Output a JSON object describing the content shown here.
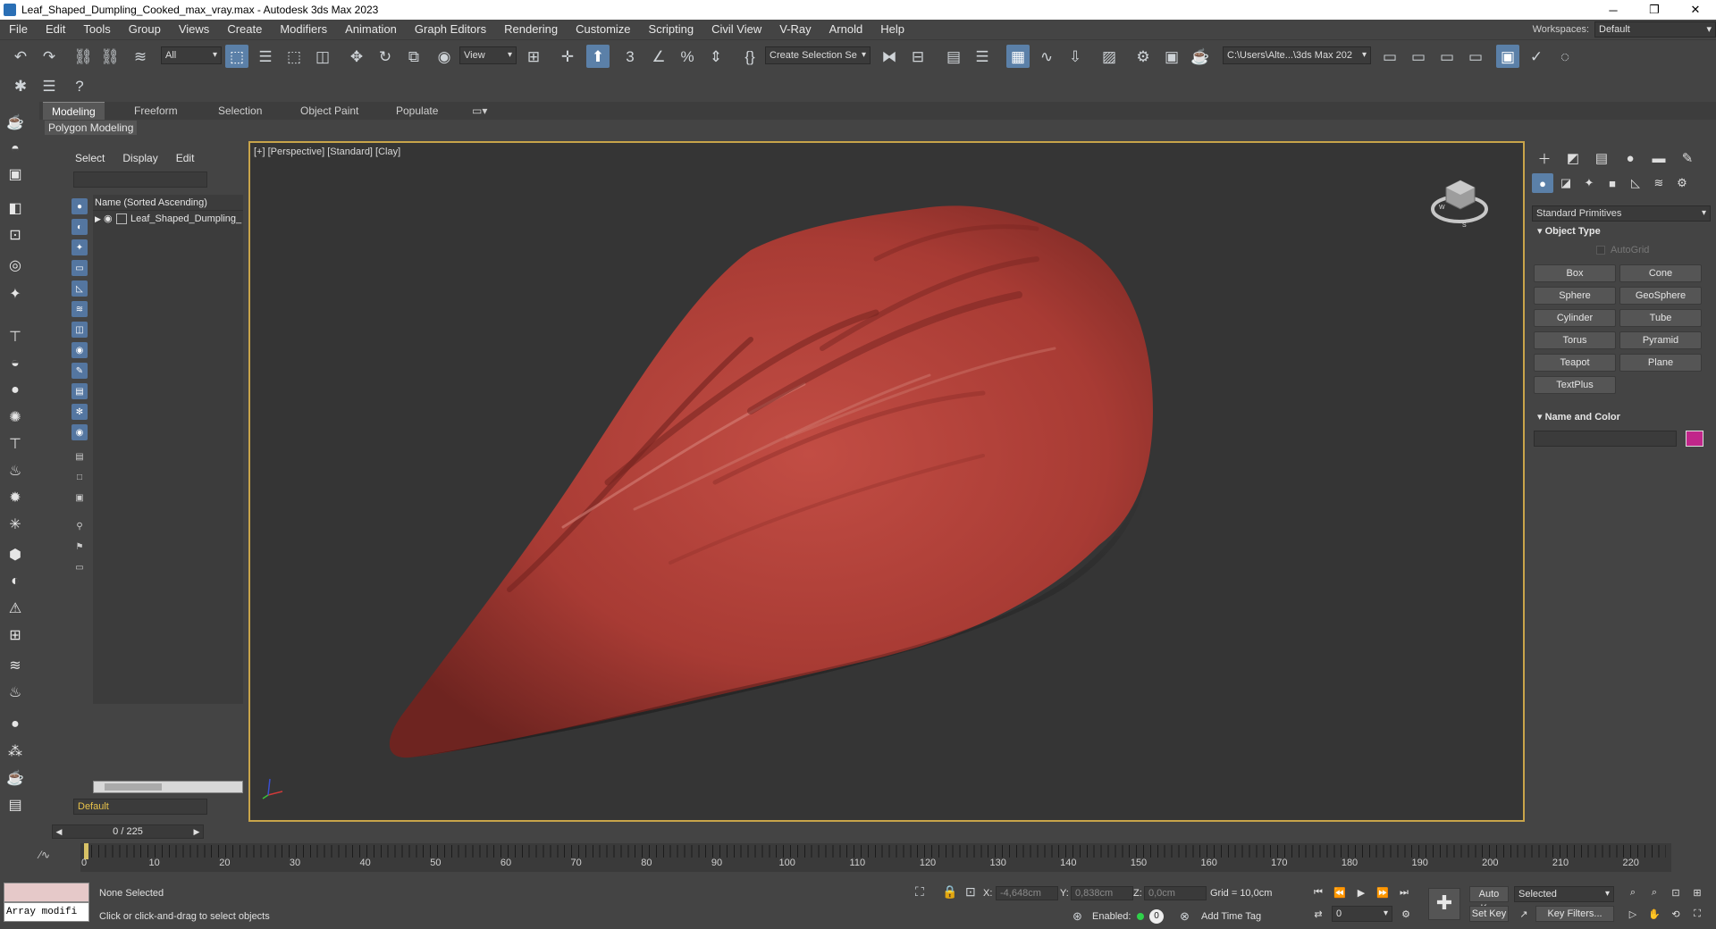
{
  "window": {
    "title": "Leaf_Shaped_Dumpling_Cooked_max_vray.max - Autodesk 3ds Max 2023",
    "controls": [
      "─",
      "❐",
      "✕"
    ]
  },
  "menu": {
    "items": [
      "File",
      "Edit",
      "Tools",
      "Group",
      "Views",
      "Create",
      "Modifiers",
      "Animation",
      "Graph Editors",
      "Rendering",
      "Customize",
      "Scripting",
      "Civil View",
      "V-Ray",
      "Arnold",
      "Help"
    ],
    "workspaces_label": "Workspaces:",
    "workspace_value": "Default"
  },
  "toolbar": {
    "selection_filter": "All",
    "ref_coord": "View",
    "named_selection": "Create Selection Se",
    "project_path": "C:\\Users\\Alte...\\3ds Max 202"
  },
  "ribbon": {
    "tabs": [
      "Modeling",
      "Freeform",
      "Selection",
      "Object Paint",
      "Populate"
    ],
    "panel_label": "Polygon Modeling"
  },
  "scene_explorer": {
    "tabs": [
      "Select",
      "Display",
      "Edit"
    ],
    "column_header": "Name (Sorted Ascending)",
    "rows": [
      "Leaf_Shaped_Dumpling_"
    ],
    "layer": "Default"
  },
  "viewport": {
    "label": "[+] [Perspective] [Standard] [Clay]",
    "object_color": "#b5463e"
  },
  "command_panel": {
    "category": "Standard Primitives",
    "object_type_title": "Object Type",
    "autogrid_label": "AutoGrid",
    "primitives": [
      "Box",
      "Cone",
      "Sphere",
      "GeoSphere",
      "Cylinder",
      "Tube",
      "Torus",
      "Pyramid",
      "Teapot",
      "Plane",
      "TextPlus"
    ],
    "name_color_title": "Name and Color",
    "swatch_color": "#c1268a"
  },
  "timeline": {
    "frame_display": "0 / 225",
    "tick_labels": [
      "0",
      "10",
      "20",
      "30",
      "40",
      "50",
      "60",
      "70",
      "80",
      "90",
      "100",
      "110",
      "120",
      "130",
      "140",
      "150",
      "160",
      "170",
      "180",
      "190",
      "200",
      "210",
      "220"
    ]
  },
  "status": {
    "maxscript_output": "Array modifi",
    "selection_status": "None Selected",
    "prompt": "Click or click-and-drag to select objects",
    "x_label": "X:",
    "x_value": "-4,648cm",
    "y_label": "Y:",
    "y_value": "0,838cm",
    "z_label": "Z:",
    "z_value": "0,0cm",
    "grid": "Grid = 10,0cm",
    "enabled_label": "Enabled:",
    "add_time_tag": "Add Time Tag",
    "auto_key": "Auto Key",
    "set_key": "Set Key",
    "key_mode": "Selected",
    "key_filters": "Key Filters...",
    "frame_field": "0"
  }
}
